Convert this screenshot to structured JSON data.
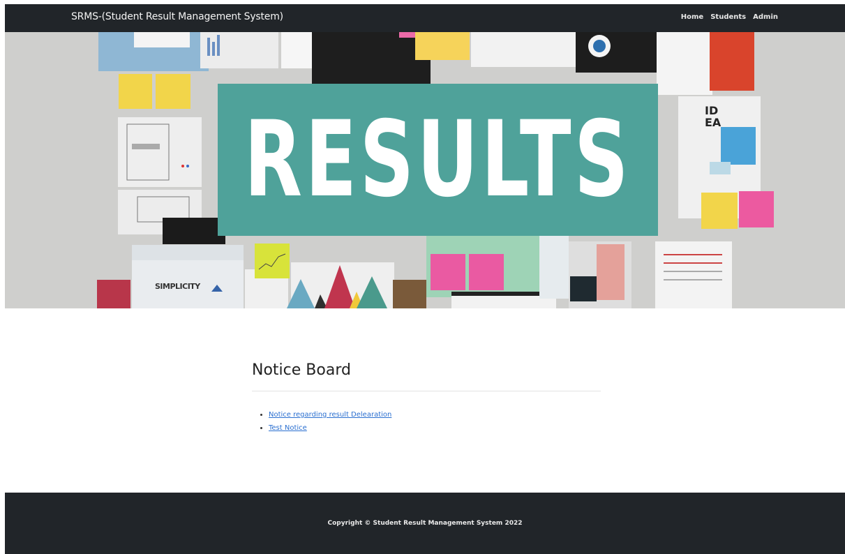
{
  "navbar": {
    "brand": "SRMS-(Student Result Management System)",
    "links": [
      "Home",
      "Students",
      "Admin"
    ]
  },
  "hero": {
    "banner_text": "RESULTS",
    "sign_text": "SIMPLICITY",
    "idea_text": "ID EA",
    "banner_color": "#4fa29a"
  },
  "notice_board": {
    "title": "Notice Board",
    "notices": [
      "Notice regarding result Delearation",
      "Test Notice"
    ]
  },
  "footer": {
    "copyright": "Copyright © Student Result Management System 2022"
  }
}
